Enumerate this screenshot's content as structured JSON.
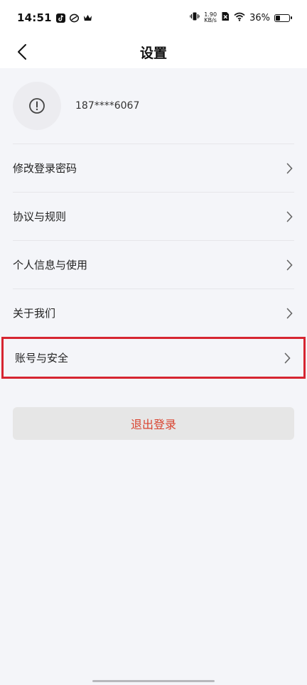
{
  "status_bar": {
    "time": "14:51",
    "net_speed_value": "1.90",
    "net_speed_unit": "KB/s",
    "battery_percent": "36%",
    "battery_level": 0.36
  },
  "nav": {
    "title": "设置",
    "back_icon": "chevron-left-icon"
  },
  "profile": {
    "avatar_icon": "exclamation-circle-icon",
    "phone": "187****6067"
  },
  "menu": {
    "items": [
      {
        "label": "修改登录密码"
      },
      {
        "label": "协议与规则"
      },
      {
        "label": "个人信息与使用"
      },
      {
        "label": "关于我们"
      },
      {
        "label": "账号与安全",
        "highlighted": true
      }
    ]
  },
  "logout": {
    "label": "退出登录",
    "color": "#d9432f"
  },
  "colors": {
    "highlight_border": "#d62531",
    "background": "#f4f5f9"
  }
}
